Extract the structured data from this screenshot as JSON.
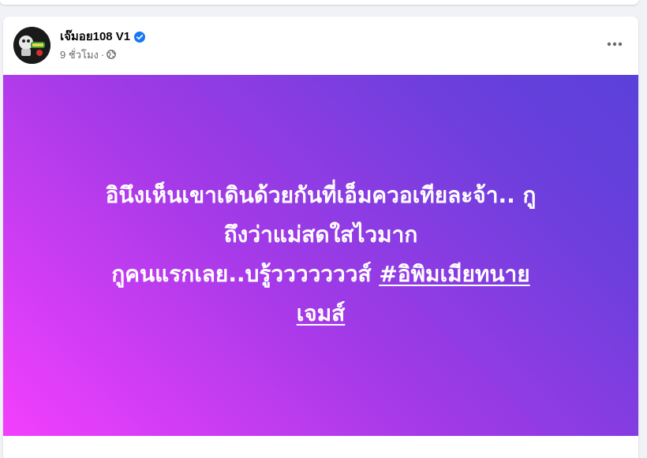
{
  "post": {
    "author": "เจ๊มอย108 V1",
    "time": "9 ชั่วโมง",
    "separator": "·",
    "status_lines": [
      "อินึงเห็นเขาเดินด้วยกันที่เอ็มควอเทียละจ้า.. กู",
      "ถึงว่าแม่สดใสไวมาก",
      "กูคนแรกเลย..บรู้วววววววส์ "
    ],
    "hashtag": "#อิพิมเมียทนายเจมส์",
    "hashtag_part1": "#อิพิมเมียทนาย",
    "hashtag_part2": "เจมส์",
    "icons": {
      "verified": "verified-badge-icon",
      "audience": "globe-icon",
      "more": "more-options-icon"
    },
    "colors": {
      "gradient_start": "#f33ffd",
      "gradient_end": "#5b40da",
      "verified": "#1877f2",
      "meta_text": "#65676b"
    }
  }
}
